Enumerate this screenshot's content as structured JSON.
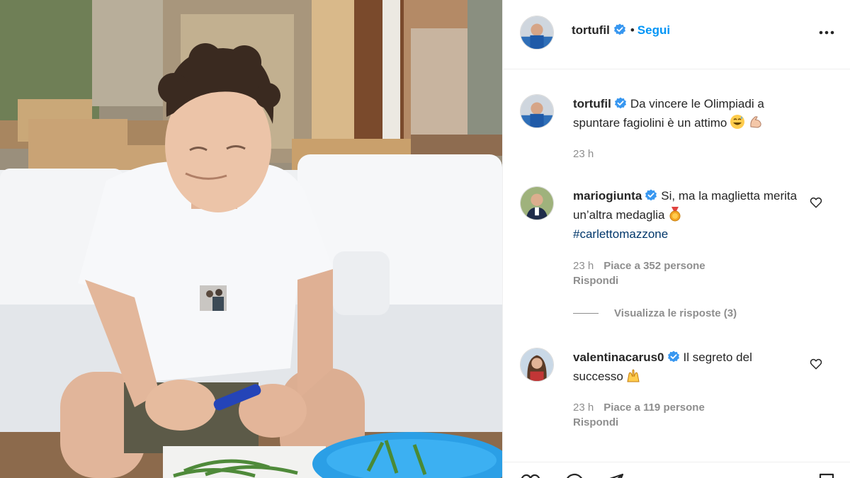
{
  "post": {
    "author": "tortufil",
    "follow_label": "Segui",
    "separator": "•"
  },
  "caption": {
    "username": "tortufil",
    "text": "Da vincere le Olimpiadi a spuntare fagiolini è un attimo",
    "emojis": [
      "grinning-sweat-emoji",
      "flexed-biceps-emoji"
    ],
    "time": "23 h"
  },
  "comments": [
    {
      "username": "mariogiunta",
      "text": "Si, ma la maglietta merita un’altra medaglia",
      "emoji": "medal-emoji",
      "hashtag": "#carlettomazzone",
      "time": "23 h",
      "likes": "Piace a 352 persone",
      "reply": "Rispondi",
      "view_replies": "Visualizza le risposte (3)"
    },
    {
      "username": "valentinacarus0",
      "text": "Il segreto del successo",
      "emoji": "raising-hands-emoji",
      "time": "23 h",
      "likes": "Piace a 119 persone",
      "reply": "Rispondi"
    }
  ],
  "colors": {
    "link_blue": "#0095f6",
    "hashtag": "#00376b",
    "verified": "#3897f0",
    "muted": "#8e8e8e"
  },
  "icons": [
    "more-options-icon",
    "heart-icon",
    "comment-icon",
    "share-icon",
    "bookmark-icon",
    "verified-badge-icon"
  ]
}
